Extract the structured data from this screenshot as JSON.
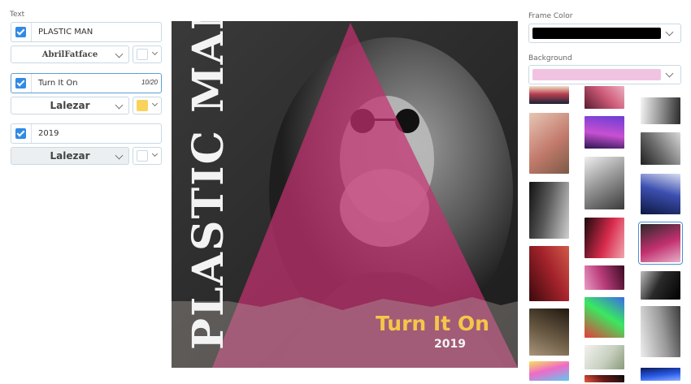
{
  "text_panel": {
    "label": "Text",
    "rows": [
      {
        "checked": true,
        "value": "PLASTIC MAN",
        "font": "AbrilFatface",
        "color": "#ffffff"
      },
      {
        "checked": true,
        "value": "Turn It On",
        "counter": "10/20",
        "font": "Lalezar",
        "color": "#f9d45c"
      },
      {
        "checked": true,
        "value": "2019",
        "font": "Lalezar",
        "color": "#ffffff"
      }
    ]
  },
  "poster": {
    "vertical_title": "PLASTIC MAN",
    "headline": "Turn It On",
    "year": "2019",
    "triangle_color": "#c2306f"
  },
  "frame_color": {
    "label": "Frame Color",
    "value": "#000000"
  },
  "background": {
    "label": "Background",
    "value": "#f1c3e2"
  },
  "thumbnails": [
    {
      "name": "thumb-street-night",
      "colors": [
        "#1b2237",
        "#b83f4f",
        "#f0e1c6"
      ],
      "selected": false
    },
    {
      "name": "thumb-pink-lights",
      "colors": [
        "#5a1c30",
        "#d05c7a",
        "#eab0c0"
      ],
      "selected": false
    },
    {
      "name": "thumb-bw-landscape",
      "colors": [
        "#f5f5f5",
        "#8a8a8a",
        "#2a2a2a"
      ],
      "selected": false
    },
    {
      "name": "thumb-flowers",
      "colors": [
        "#e7c6b4",
        "#c27a6c",
        "#7b5a46"
      ],
      "selected": false
    },
    {
      "name": "thumb-purple-dancer",
      "colors": [
        "#6b3cd4",
        "#c850d2",
        "#2b1650"
      ],
      "selected": false
    },
    {
      "name": "thumb-bw-woman",
      "colors": [
        "#d8d8d8",
        "#6c6c6c",
        "#1f1f1f"
      ],
      "selected": false
    },
    {
      "name": "thumb-bw-man-face",
      "colors": [
        "#cfcfcf",
        "#5a5a5a",
        "#121212"
      ],
      "selected": false
    },
    {
      "name": "thumb-bw-coat",
      "colors": [
        "#3a3a3a",
        "#9a9a9a",
        "#efefef"
      ],
      "selected": false
    },
    {
      "name": "thumb-blue-dancer",
      "colors": [
        "#0d1840",
        "#3c4fb0",
        "#d8dcf0"
      ],
      "selected": false
    },
    {
      "name": "thumb-red-portrait",
      "colors": [
        "#3b0a0d",
        "#a3222b",
        "#d15a4a"
      ],
      "selected": false
    },
    {
      "name": "thumb-red-sunglasses",
      "colors": [
        "#1a0a0c",
        "#d82a4c",
        "#f0a5b0"
      ],
      "selected": false
    },
    {
      "name": "thumb-pink-triangle-portrait",
      "colors": [
        "#2a2a2a",
        "#c2306f",
        "#e7b0c9"
      ],
      "selected": true
    },
    {
      "name": "thumb-dark-man",
      "colors": [
        "#201810",
        "#6a5a44",
        "#a8947a"
      ],
      "selected": false
    },
    {
      "name": "thumb-pink-figure",
      "colors": [
        "#3a0a22",
        "#b93c7a",
        "#e99bc4"
      ],
      "selected": false
    },
    {
      "name": "thumb-dark-hand",
      "colors": [
        "#000000",
        "#2a2a2a",
        "#bcbcbc"
      ],
      "selected": false
    },
    {
      "name": "thumb-glitch-face",
      "colors": [
        "#5ec8f0",
        "#f06ac8",
        "#f6e25a"
      ],
      "selected": false
    },
    {
      "name": "thumb-glitch-bars",
      "colors": [
        "#e83a3a",
        "#3ae860",
        "#3a6ae8"
      ],
      "selected": false
    },
    {
      "name": "thumb-bw-arms",
      "colors": [
        "#ededed",
        "#9a9a9a",
        "#3c3c3c"
      ],
      "selected": false
    },
    {
      "name": "thumb-white-flower",
      "colors": [
        "#f2f2ee",
        "#c8d0c0",
        "#8a9a7a"
      ],
      "selected": false
    },
    {
      "name": "thumb-blue-lights",
      "colors": [
        "#0a1a5a",
        "#2a5ae8",
        "#8ab0ff"
      ],
      "selected": false
    },
    {
      "name": "thumb-red-stage",
      "colors": [
        "#0a0a0a",
        "#6a1a1a",
        "#e85a3a"
      ],
      "selected": false
    }
  ]
}
